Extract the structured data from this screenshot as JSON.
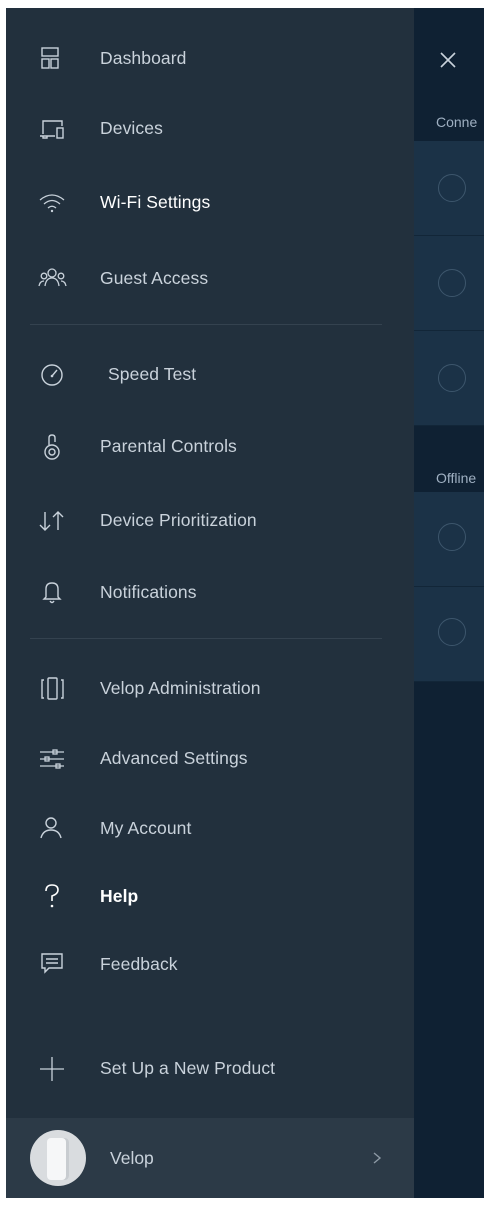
{
  "menu": {
    "items": [
      {
        "label": "Dashboard",
        "icon": "dashboard-icon"
      },
      {
        "label": "Devices",
        "icon": "devices-icon"
      },
      {
        "label": "Wi-Fi Settings",
        "icon": "wifi-icon"
      },
      {
        "label": "Guest Access",
        "icon": "guest-access-icon"
      },
      {
        "label": "Speed Test",
        "icon": "speedometer-icon"
      },
      {
        "label": "Parental Controls",
        "icon": "lock-icon"
      },
      {
        "label": "Device Prioritization",
        "icon": "up-down-arrows-icon"
      },
      {
        "label": "Notifications",
        "icon": "bell-icon"
      },
      {
        "label": "Velop Administration",
        "icon": "node-icon"
      },
      {
        "label": "Advanced Settings",
        "icon": "sliders-icon"
      },
      {
        "label": "My Account",
        "icon": "user-icon"
      },
      {
        "label": "Help",
        "icon": "question-mark-icon"
      },
      {
        "label": "Feedback",
        "icon": "speech-bubble-icon"
      },
      {
        "label": "Set Up a New Product",
        "icon": "plus-icon"
      }
    ]
  },
  "footer": {
    "label": "Velop",
    "icon": "chevron-right-icon"
  },
  "background": {
    "connected_heading": "Conne",
    "offline_heading": "Offline"
  },
  "colors": {
    "drawer_bg": "#22303d",
    "footer_bg": "#2c3a47",
    "page_bg": "#0f2133",
    "card_bg": "#1b3247"
  }
}
